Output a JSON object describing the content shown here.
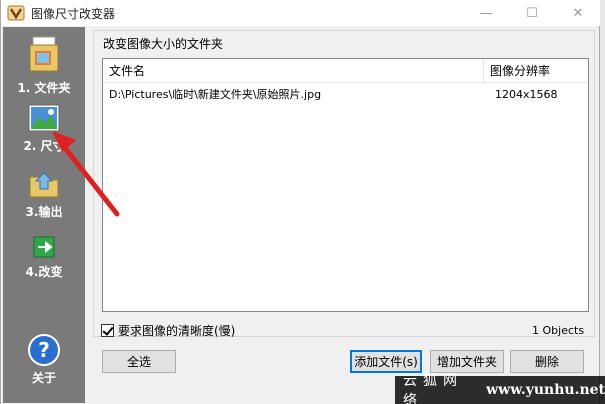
{
  "window": {
    "title": "图像尺寸改变器",
    "minimize": "—",
    "maximize": "☐",
    "close": "✕"
  },
  "sidebar": {
    "items": [
      {
        "label": "1. 文件夹",
        "icon": "folder-document-icon"
      },
      {
        "label": "2. 尺寸",
        "icon": "landscape-picture-icon"
      },
      {
        "label": "3.输出",
        "icon": "folder-output-icon"
      },
      {
        "label": "4.改变",
        "icon": "green-arrow-icon"
      },
      {
        "label": "关于",
        "icon": "help-question-icon"
      }
    ]
  },
  "main": {
    "group_title": "改变图像大小的文件夹",
    "columns": [
      "文件名",
      "图像分辨率"
    ],
    "rows": [
      {
        "file": "D:\\Pictures\\临时\\新建文件夹\\原始照片.jpg",
        "resolution": "1204x1568"
      }
    ],
    "checkbox_label": "要求图像的清晰度(慢)",
    "checkbox_checked": true,
    "object_count": "1 Objects",
    "buttons": {
      "select_all": "全选",
      "add_file": "添加文件(s)",
      "add_folder": "增加文件夹",
      "delete": "删除"
    }
  },
  "watermark": {
    "cn": "云狐网络",
    "url": "www.yunhu.net"
  },
  "colors": {
    "sidebar": "#7a7a7a",
    "annotation_arrow": "#e02020",
    "focus": "#0078d7"
  }
}
